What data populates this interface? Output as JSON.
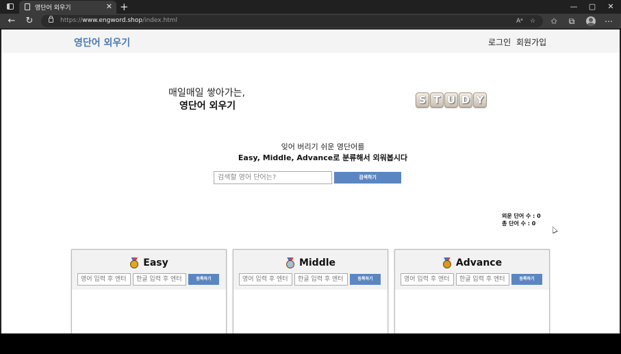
{
  "browser": {
    "tab_title": "영단어 외우기",
    "tab_close": "✕",
    "new_tab": "+",
    "url_prefix": "https://",
    "url_domain": "www.engword.shop",
    "url_path": "/index.html",
    "window_controls": [
      "—",
      "▢",
      "✕"
    ]
  },
  "header": {
    "site_title": "영단어 외우기",
    "login": "로그인",
    "signup": "회원가입"
  },
  "hero": {
    "line1": "매일매일 쌓아가는,",
    "line2": "영단어 외우기",
    "dice_letters": [
      "S",
      "T",
      "U",
      "D",
      "Y"
    ]
  },
  "tagline": {
    "line1": "잊어 버리기 쉬운 영단어를",
    "line2": "Easy, Middle, Advance로 분류해서 외워봅시다"
  },
  "search": {
    "placeholder": "검색할 영어 단어는?",
    "button": "검색하기"
  },
  "stats": {
    "memorized": "외운 단어 수 : 0",
    "total": "총 단어 수 : 0"
  },
  "cards": [
    {
      "title": "Easy",
      "medal_color": "#e0a820",
      "eng_placeholder": "영어 입력 후 엔터",
      "kor_placeholder": "한글 입력 후 엔터",
      "button": "등록하기"
    },
    {
      "title": "Middle",
      "medal_color": "#a9bfd1",
      "eng_placeholder": "영어 입력 후 엔터",
      "kor_placeholder": "한글 입력 후 엔터",
      "button": "등록하기"
    },
    {
      "title": "Advance",
      "medal_color": "#d99a1e",
      "eng_placeholder": "영어 입력 후 엔터",
      "kor_placeholder": "한글 입력 후 엔터",
      "button": "등록하기"
    }
  ],
  "colors": {
    "brand": "#4a79b3",
    "button": "#5b86c1"
  }
}
